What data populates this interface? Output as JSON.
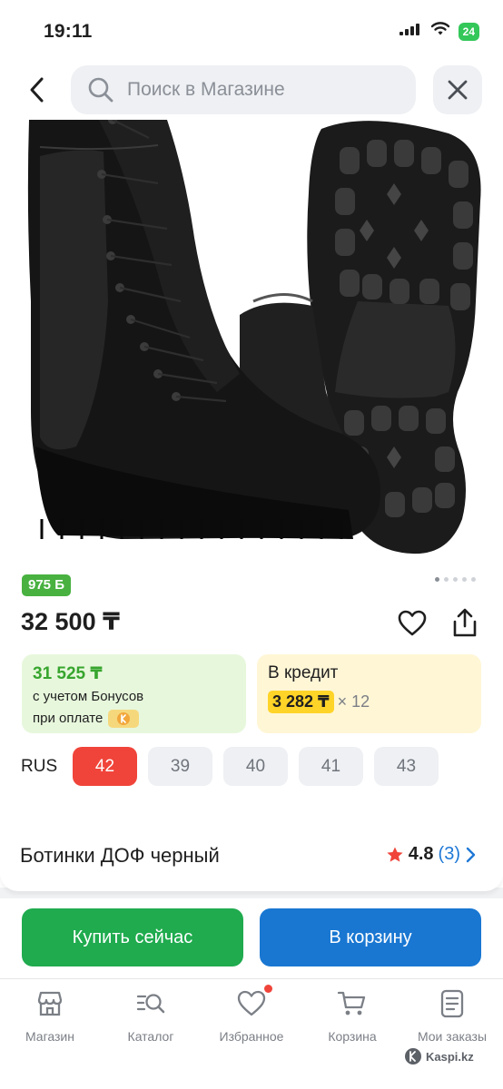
{
  "status_bar": {
    "time": "19:11",
    "battery": "24"
  },
  "search": {
    "placeholder": "Поиск в Магазине"
  },
  "product": {
    "bonus_badge": "975 Б",
    "price": "32 500 ₸",
    "title": "Ботинки ДОФ черный",
    "rating": "4.8",
    "reviews": "(3)",
    "image_count": 5,
    "image_index": 1
  },
  "bonus_card": {
    "price": "31 525 ₸",
    "line1": "с учетом Бонусов",
    "line2": "при оплате"
  },
  "credit_card": {
    "title": "В кредит",
    "amount": "3 282 ₸",
    "months": "× 12"
  },
  "sizes": {
    "label": "RUS",
    "options": [
      "42",
      "39",
      "40",
      "41",
      "43"
    ],
    "selected": "42"
  },
  "actions": {
    "buy_now": "Купить сейчас",
    "add_to_cart": "В корзину"
  },
  "nav": {
    "items": [
      {
        "label": "Магазин",
        "icon": "store-icon"
      },
      {
        "label": "Каталог",
        "icon": "catalog-search-icon"
      },
      {
        "label": "Избранное",
        "icon": "heart-icon"
      },
      {
        "label": "Корзина",
        "icon": "cart-icon"
      },
      {
        "label": "Мои заказы",
        "icon": "orders-icon"
      }
    ]
  },
  "watermark": "Kaspi.kz",
  "colors": {
    "accent_red": "#f0443a",
    "bonus_green": "#48b140",
    "buy_green": "#1fab4e",
    "cart_blue": "#1977d2",
    "credit_yellow": "#ffd428"
  }
}
